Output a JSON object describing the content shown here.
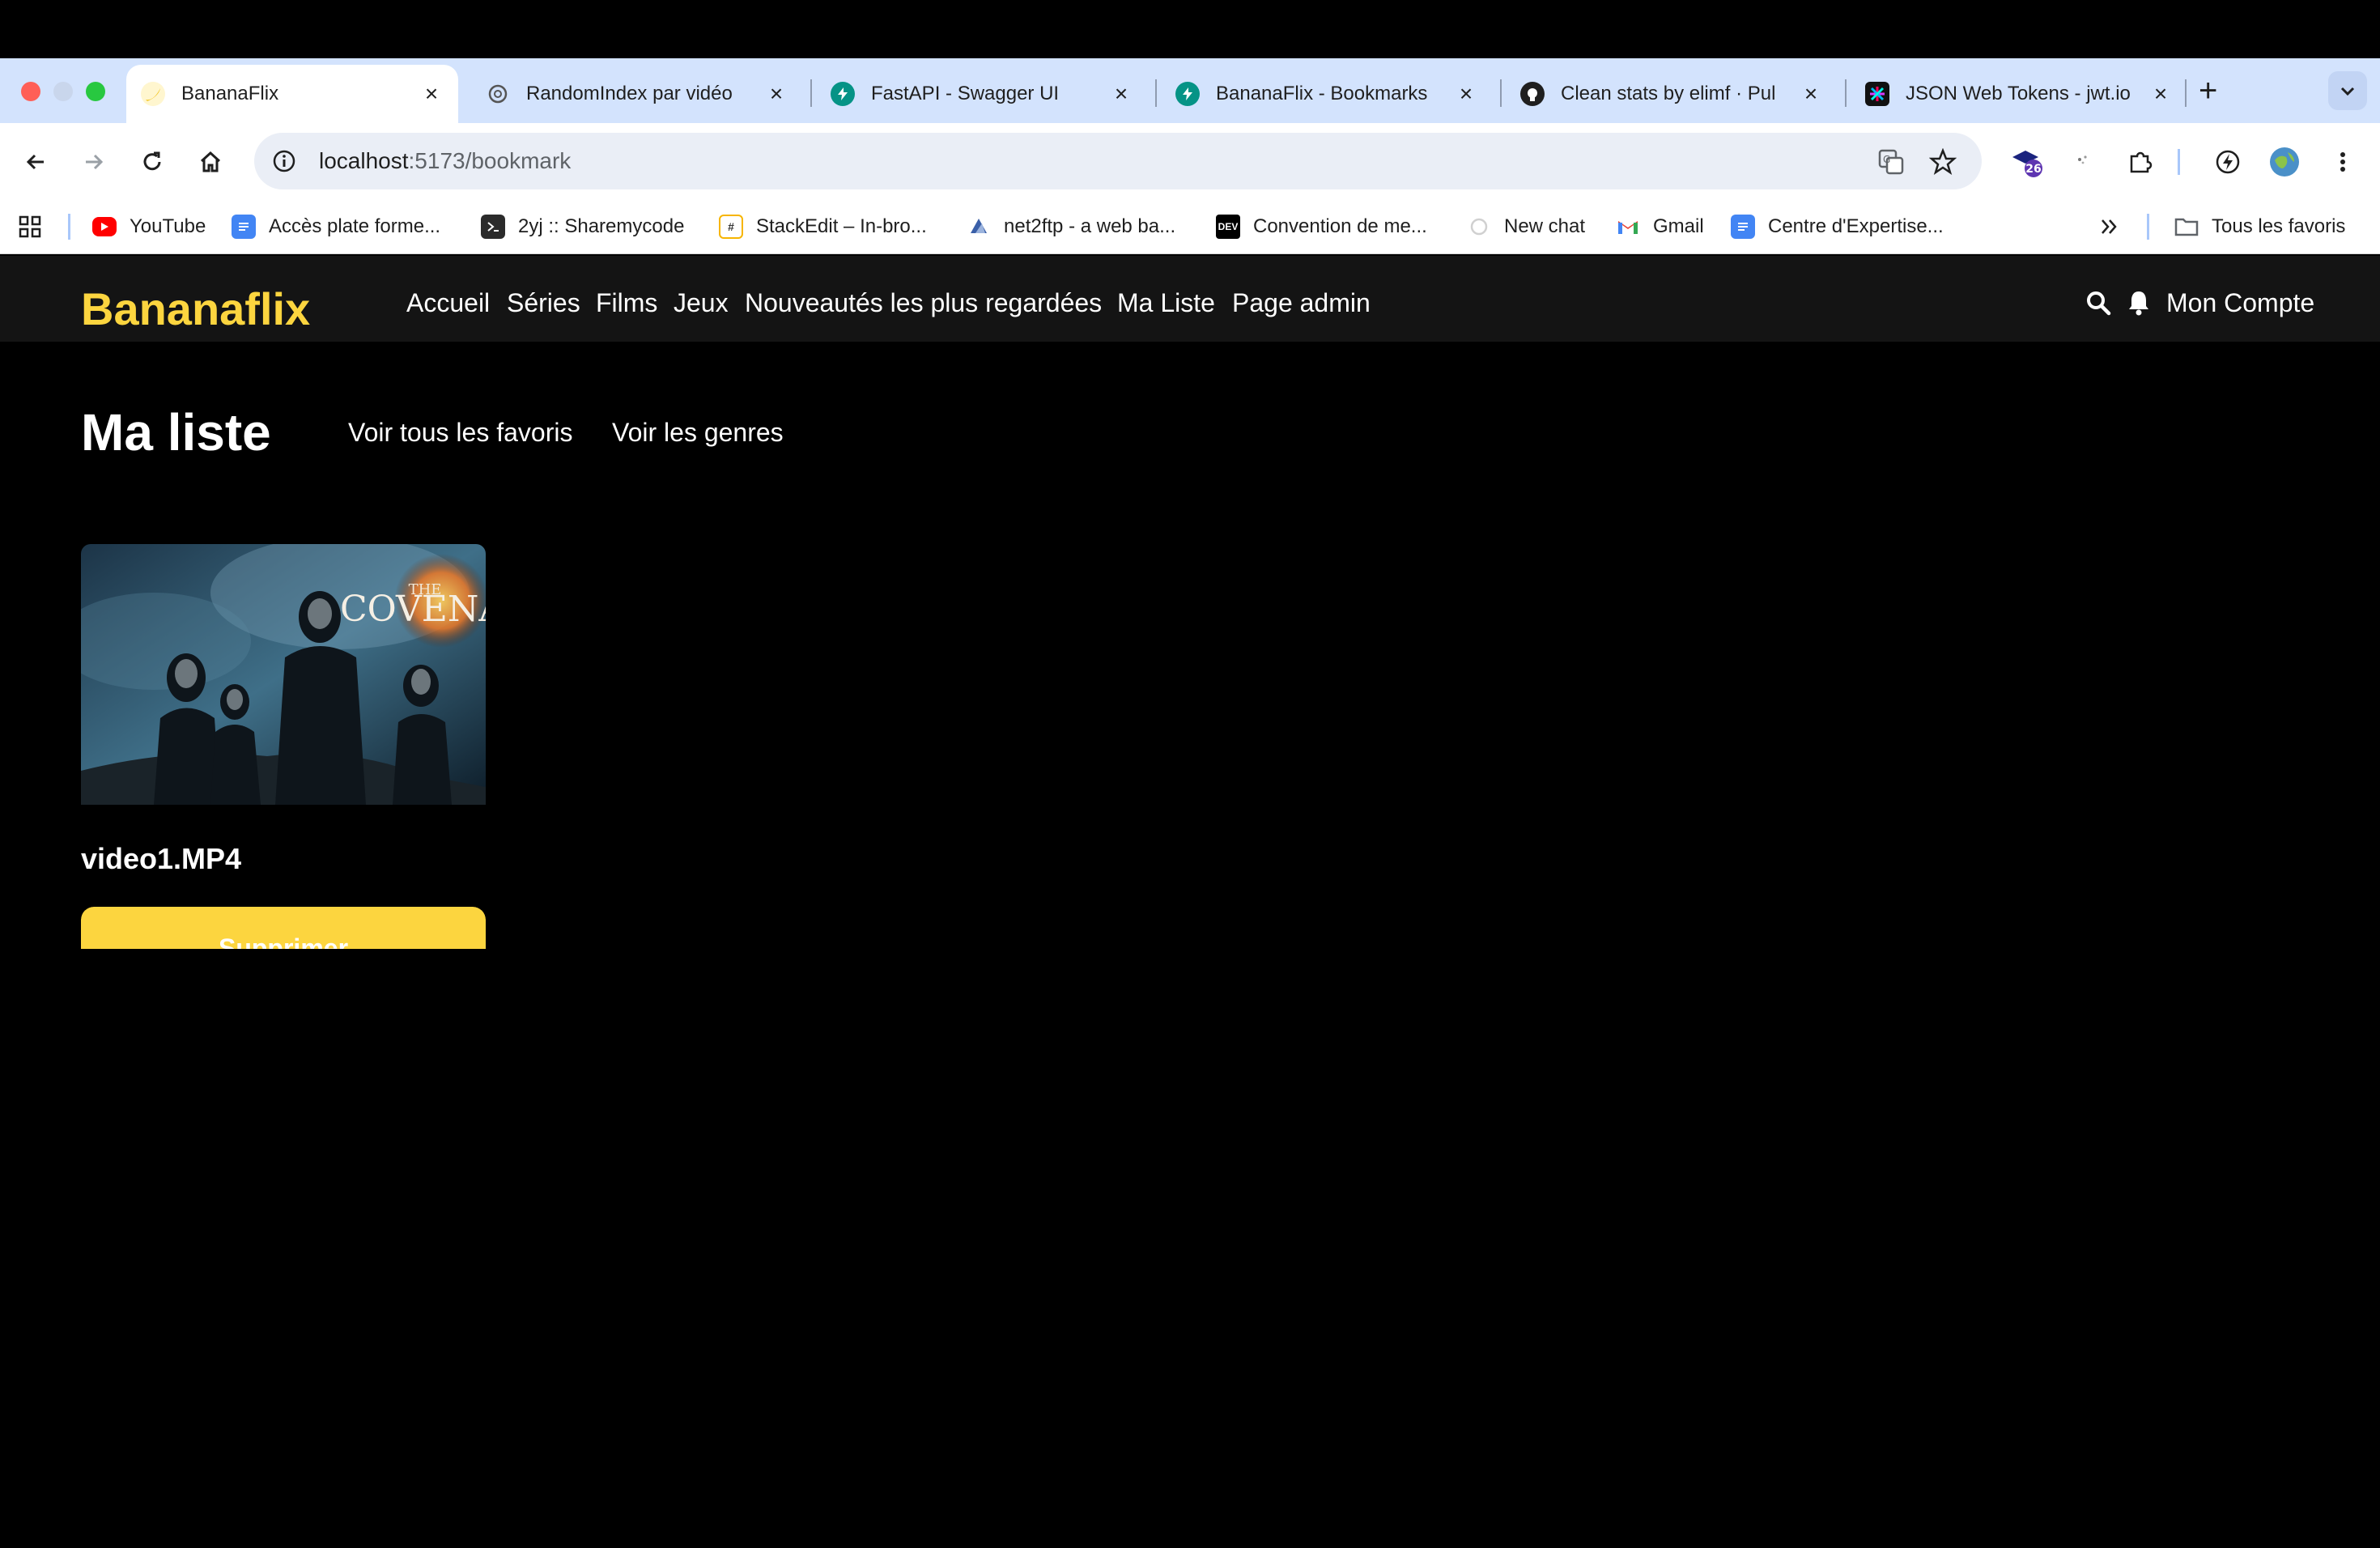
{
  "browser": {
    "tabs": [
      {
        "title": "BananaFlix",
        "active": true,
        "icon": "banana-icon"
      },
      {
        "title": "RandomIndex par vidéo",
        "active": false,
        "icon": "openai-icon"
      },
      {
        "title": "FastAPI - Swagger UI",
        "active": false,
        "icon": "fastapi-icon"
      },
      {
        "title": "BananaFlix - Bookmarks",
        "active": false,
        "icon": "fastapi-icon"
      },
      {
        "title": "Clean stats by elimf · Pul",
        "active": false,
        "icon": "github-icon"
      },
      {
        "title": "JSON Web Tokens - jwt.io",
        "active": false,
        "icon": "jwt-icon"
      }
    ],
    "new_tab_label": "+",
    "url_host": "localhost",
    "url_path": ":5173/bookmark",
    "extension_badge": "26",
    "bookmarks": [
      {
        "label": "YouTube",
        "icon": "youtube-icon"
      },
      {
        "label": "Accès plate forme...",
        "icon": "docs-icon"
      },
      {
        "label": "2yj :: Sharemycode",
        "icon": "terminal-icon"
      },
      {
        "label": "StackEdit – In-bro...",
        "icon": "stackedit-icon"
      },
      {
        "label": "net2ftp - a web ba...",
        "icon": "net2ftp-icon"
      },
      {
        "label": "Convention de me...",
        "icon": "dev-icon"
      },
      {
        "label": "New chat",
        "icon": "openai-icon"
      },
      {
        "label": "Gmail",
        "icon": "gmail-icon"
      },
      {
        "label": "Centre d'Expertise...",
        "icon": "docs-icon"
      }
    ],
    "all_bookmarks_label": "Tous les favoris",
    "dev_icon_text": "DEV"
  },
  "site": {
    "logo": "Bananaflix",
    "nav": [
      "Accueil",
      "Séries",
      "Films",
      "Jeux",
      "Nouveautés les plus regardées",
      "Ma Liste",
      "Page admin"
    ],
    "account_label": "Mon Compte"
  },
  "page": {
    "title": "Ma liste",
    "links": [
      "Voir tous les favoris",
      "Voir les genres"
    ],
    "items": [
      {
        "title": "video1.MP4",
        "poster_text": "COVENA",
        "poster_small": "THE",
        "delete_label": "Supprimer"
      }
    ]
  },
  "colors": {
    "accent": "#fcd53f",
    "header_bg": "#141414",
    "page_bg": "#000000",
    "tabbar_bg": "#d3e3fd"
  }
}
